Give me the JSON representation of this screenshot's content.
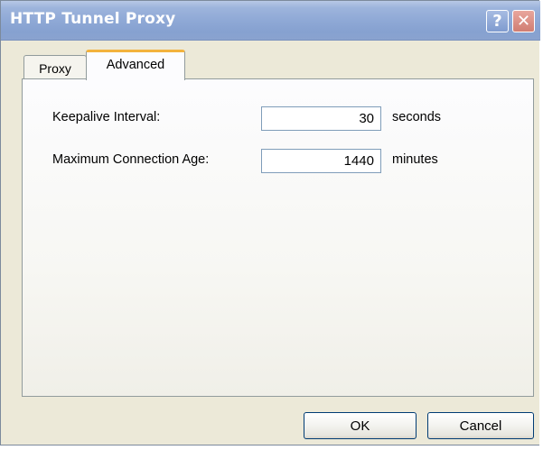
{
  "window": {
    "title": "HTTP Tunnel Proxy"
  },
  "titlebar_buttons": {
    "help_label": "?",
    "close_label": "✕"
  },
  "tabs": [
    {
      "label": "Proxy",
      "selected": false
    },
    {
      "label": "Advanced",
      "selected": true
    }
  ],
  "settings": {
    "keepalive": {
      "label": "Keepalive Interval:",
      "value": "30",
      "unit": "seconds"
    },
    "max_age": {
      "label": "Maximum Connection Age:",
      "value": "1440",
      "unit": "minutes"
    }
  },
  "buttons": {
    "ok": "OK",
    "cancel": "Cancel"
  },
  "colors": {
    "titlebar": "#8fa9d6",
    "active_tab_accent": "#f3b33d",
    "dialog_background": "#ece9d8",
    "close_button": "#d07d72"
  },
  "icons": {
    "help": "help-icon",
    "close": "close-icon"
  }
}
